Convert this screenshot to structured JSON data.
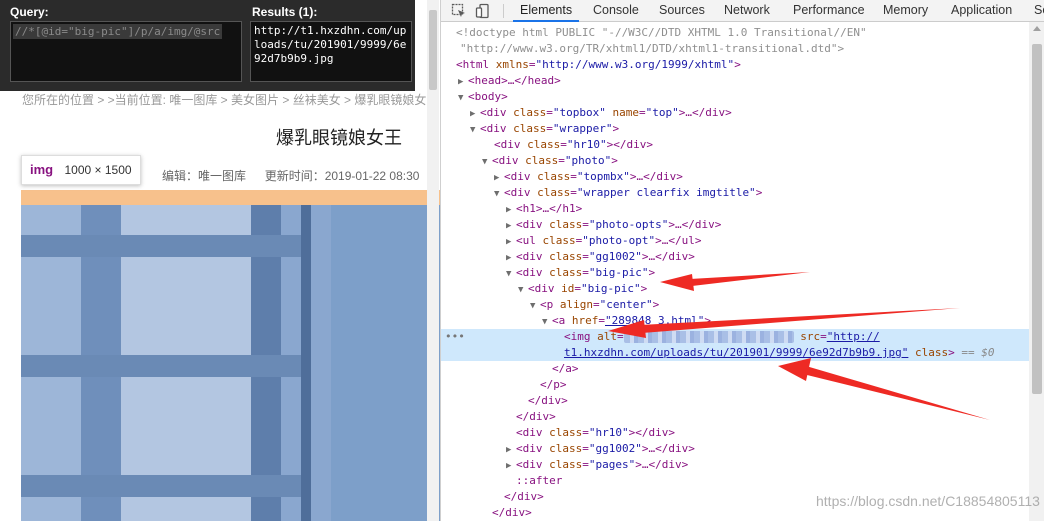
{
  "xpath_helper": {
    "query_label": "Query:",
    "query_value": "//*[@id=\"big-pic\"]/p/a/img/@src",
    "results_label": "Results (1):",
    "results_value": "http://t1.hxzdhn.com/uploads/tu/201901/9999/6e92d7b9b9.jpg"
  },
  "page": {
    "breadcrumb": "您所在的位置 > >当前位置: 唯一图库 > 美女图片 > 丝袜美女 > 爆乳眼镜娘女",
    "title": "爆乳眼镜娘女王",
    "meta_editor": "编辑：唯一图库",
    "meta_time": "更新时间：2019-01-22 08:30",
    "tooltip_tag": "img",
    "tooltip_dims": "1000 × 1500"
  },
  "devtools": {
    "tabs": [
      "Elements",
      "Console",
      "Sources",
      "Network",
      "Performance",
      "Memory",
      "Application",
      "Se"
    ],
    "active_tab": "Elements",
    "icons": [
      "inspect-icon",
      "device-toggle-icon"
    ],
    "tree": {
      "doctype_1": "<!doctype html PUBLIC \"-//W3C//DTD XHTML 1.0 Transitional//EN\"",
      "doctype_2": "\"http://www.w3.org/TR/xhtml1/DTD/xhtml1-transitional.dtd\">",
      "html_tag": "<html",
      "html_attr": "xmlns",
      "html_val": "\"http://www.w3.org/1999/xhtml\"",
      "head": "<head>…</head>",
      "body": "<body>",
      "div_topbox_attr2": "name",
      "topbox_val": "\"topbox\"",
      "top_val": "\"top\"",
      "wrapper_val": "\"wrapper\"",
      "hr10_val": "\"hr10\"",
      "photo_val": "\"photo\"",
      "topmbx_val": "\"topmbx\"",
      "imgtitle_val": "\"wrapper clearfix imgtitle\"",
      "h1": "<h1>…</h1>",
      "photo_opts_val": "\"photo-opts\"",
      "photo_opt_val": "\"photo-opt\"",
      "gg1002_val": "\"gg1002\"",
      "big_pic_class_val": "\"big-pic\"",
      "big_pic_id_val": "\"big-pic\"",
      "p_align_val": "\"center\"",
      "a_href_val": "\"289848_3.html\"",
      "img_src_1": "\"http://",
      "img_src_2": "t1.hxzdhn.com/uploads/tu/201901/9999/6e92d7b9b9.jpg\"",
      "eq0": "== $0",
      "pages_val": "\"pages\"",
      "after": "::after"
    }
  },
  "watermark": "https://blog.csdn.net/C18854805113"
}
